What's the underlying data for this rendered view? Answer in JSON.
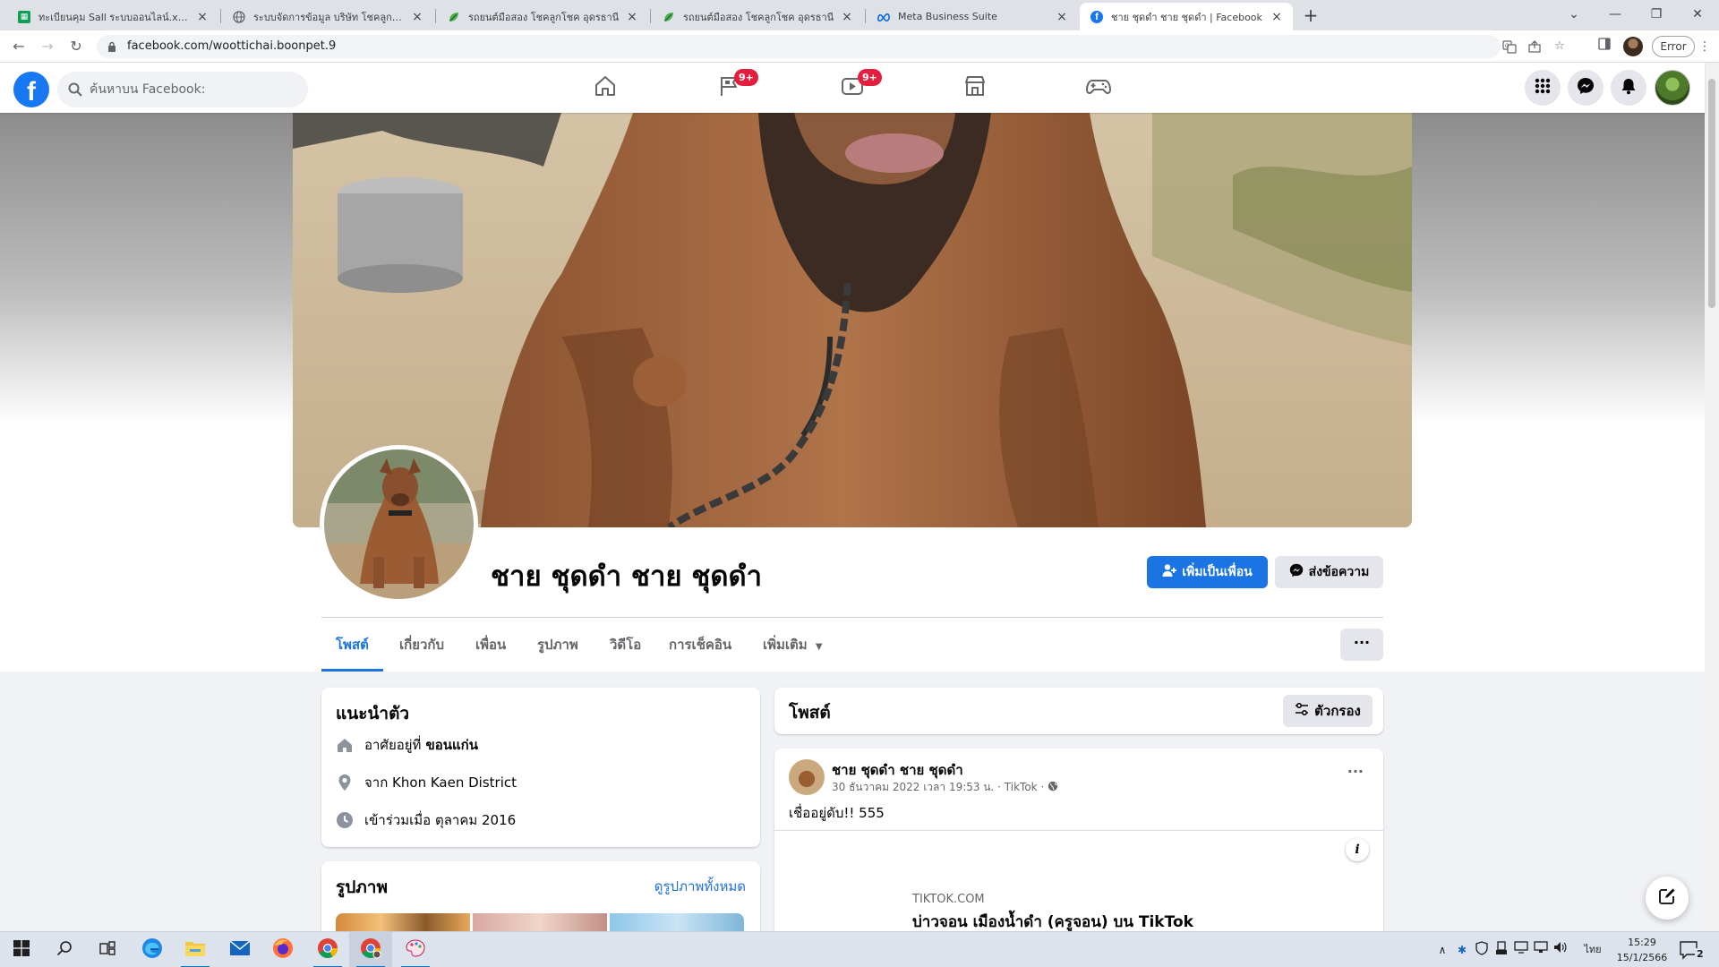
{
  "browser": {
    "tabs": [
      {
        "title": "ทะเบียนคุม Sall ระบบออนไลน์.xlsx - G",
        "favicon": "sheets-icon",
        "active": false
      },
      {
        "title": "ระบบจัดการข้อมูล บริษัท โชคลูกโชค อ",
        "favicon": "globe-icon",
        "active": false
      },
      {
        "title": "รถยนต์มือสอง โชคลูกโชค อุดรธานี",
        "favicon": "leaf-icon",
        "active": false
      },
      {
        "title": "รถยนต์มือสอง โชคลูกโชค อุดรธานี",
        "favicon": "leaf-icon",
        "active": false
      },
      {
        "title": "Meta Business Suite",
        "favicon": "meta-icon",
        "active": false
      },
      {
        "title": "ชาย ชุดดำ ชาย ชุดดำ | Facebook",
        "favicon": "facebook-icon",
        "active": true
      }
    ],
    "url": "facebook.com/woottichai.boonpet.9",
    "profile_button": "Error"
  },
  "fb": {
    "search_placeholder": "ค้นหาบน Facebook:",
    "nav": [
      {
        "name": "home",
        "badge": ""
      },
      {
        "name": "pages",
        "badge": "9+"
      },
      {
        "name": "watch",
        "badge": "9+"
      },
      {
        "name": "marketplace",
        "badge": ""
      },
      {
        "name": "gaming",
        "badge": ""
      }
    ]
  },
  "profile": {
    "name": "ชาย ชุดดำ ชาย ชุดดำ",
    "add_friend": "เพิ่มเป็นเพื่อน",
    "message": "ส่งข้อความ",
    "tabs": [
      "โพสต์",
      "เกี่ยวกับ",
      "เพื่อน",
      "รูปภาพ",
      "วิดีโอ",
      "การเช็คอิน",
      "เพิ่มเติม"
    ],
    "active_tab": "โพสต์"
  },
  "intro": {
    "title": "แนะนำตัว",
    "lives_prefix": "อาศัยอยู่ที่",
    "lives_value": "ขอนแก่น",
    "from": "จาก Khon Kaen District",
    "joined": "เข้าร่วมเมื่อ ตุลาคม 2016"
  },
  "photos": {
    "title": "รูปภาพ",
    "see_all": "ดูรูปภาพทั้งหมด"
  },
  "posts": {
    "title": "โพสต์",
    "filter": "ตัวกรอง",
    "post": {
      "author": "ชาย ชุดดำ ชาย ชุดดำ",
      "meta": "30 ธันวาคม 2022 เวลา 19:53 น. · TikTok ·",
      "text": "เชื่ออยู่ดับ!! 555",
      "link_domain": "TIKTOK.COM",
      "link_title": "บ่าวจอน เมืองน้ำดำ (ครูจอน) บน TikTok"
    }
  },
  "taskbar": {
    "time": "15:29",
    "date": "15/1/2566",
    "lang": "ไทย",
    "notifications": "2"
  },
  "colors": {
    "fb_blue": "#1877f2",
    "link_blue": "#216fdb",
    "badge_red": "#e41e3f",
    "page_bg": "#f0f2f5"
  }
}
